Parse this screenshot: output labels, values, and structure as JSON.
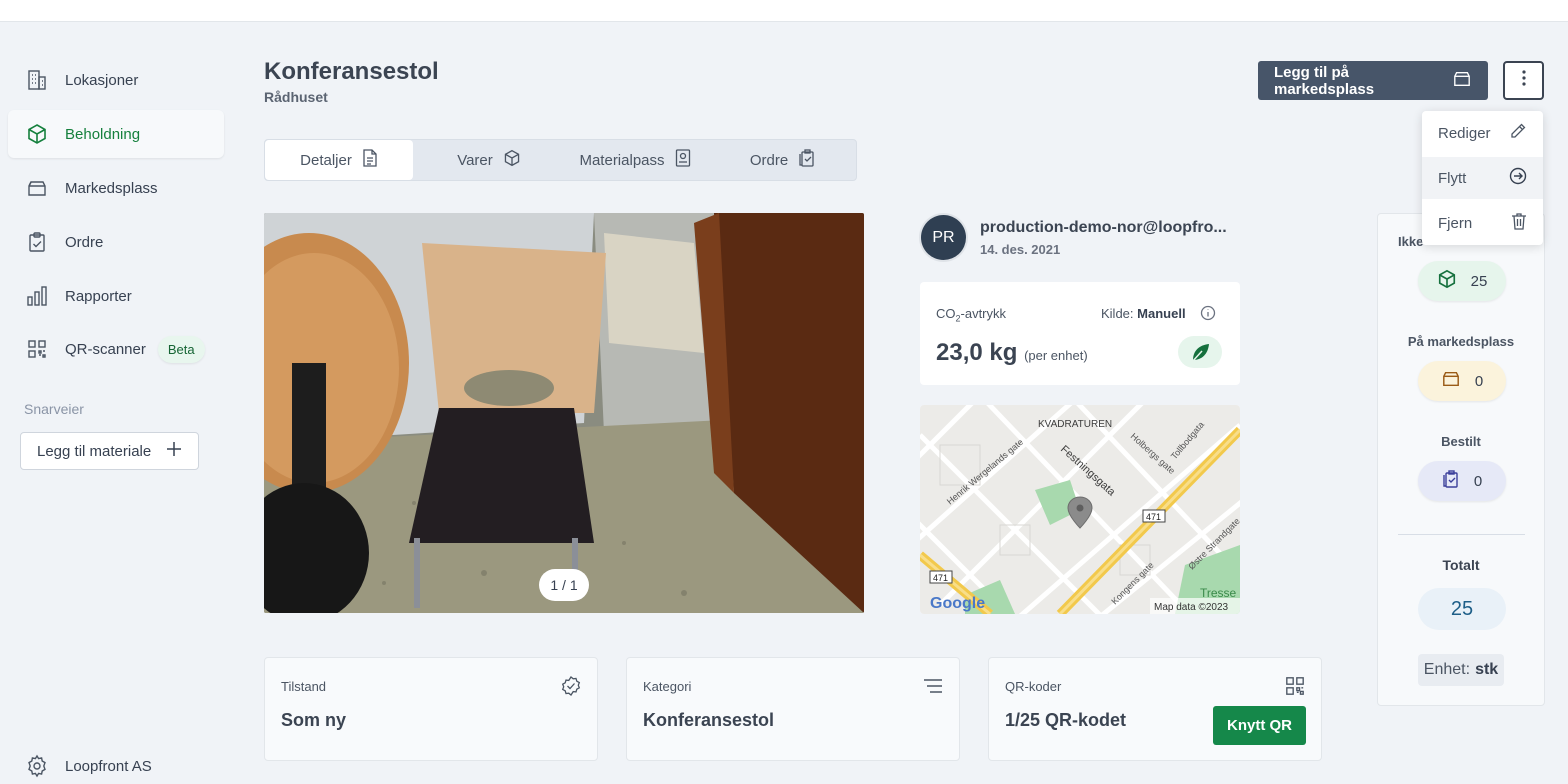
{
  "sidebar": {
    "items": [
      {
        "label": "Lokasjoner",
        "icon": "building-icon"
      },
      {
        "label": "Beholdning",
        "icon": "cube-icon"
      },
      {
        "label": "Markedsplass",
        "icon": "storage-icon"
      },
      {
        "label": "Ordre",
        "icon": "clipboard-check-icon"
      },
      {
        "label": "Rapporter",
        "icon": "bar-chart-icon"
      },
      {
        "label": "QR-scanner",
        "icon": "qr-code-icon",
        "badge": "Beta"
      }
    ],
    "active_index": 1,
    "shortcuts_title": "Snarveier",
    "add_material": "Legg til materiale",
    "organization": "Loopfront AS"
  },
  "header": {
    "title": "Konferansestol",
    "subtitle": "Rådhuset",
    "market_button": "Legg til på markedsplass"
  },
  "dropdown": {
    "items": [
      {
        "label": "Rediger",
        "icon": "pencil-icon"
      },
      {
        "label": "Flytt",
        "icon": "arrow-right-circle-icon"
      },
      {
        "label": "Fjern",
        "icon": "trash-icon"
      }
    ]
  },
  "tabs": [
    {
      "label": "Detaljer",
      "icon": "document-icon"
    },
    {
      "label": "Varer",
      "icon": "cube-icon"
    },
    {
      "label": "Materialpass",
      "icon": "id-badge-icon"
    },
    {
      "label": "Ordre",
      "icon": "clipboard-copy-icon"
    }
  ],
  "photo": {
    "counter": "1 / 1"
  },
  "owner": {
    "initials": "PR",
    "email": "production-demo-nor@loopfro...",
    "date": "14. des. 2021"
  },
  "co2": {
    "label_prefix": "CO",
    "label_sub": "2",
    "label_suffix": "-avtrykk",
    "source_label": "Kilde:",
    "source_value": "Manuell",
    "value": "23,0 kg",
    "unit": "(per enhet)"
  },
  "map": {
    "labels": {
      "district": "KVADRATUREN",
      "street1": "Henrik Wergelands gate",
      "street2": "Festningsgata",
      "street3": "Holbergs gate",
      "street4": "Tollbodgata",
      "street5": "Kongens gate",
      "street6": "Østre Strandgate",
      "road_num": "471",
      "place": "Tresse"
    },
    "logo": "Google",
    "attribution": "Map data ©2023"
  },
  "stats": {
    "first_label": "Ikke",
    "first_value": "25",
    "market_label": "På markedsplass",
    "market_value": "0",
    "ordered_label": "Bestilt",
    "ordered_value": "0",
    "total_label": "Totalt",
    "total_value": "25",
    "unit_label": "Enhet:",
    "unit_value": "stk"
  },
  "cards": {
    "condition_label": "Tilstand",
    "condition_value": "Som ny",
    "category_label": "Kategori",
    "category_value": "Konferansestol",
    "qr_label": "QR-koder",
    "qr_value": "1/25 QR-kodet",
    "qr_button": "Knytt QR"
  },
  "colors": {
    "accent_green": "#15884a",
    "dark_button": "#475569",
    "active_nav": "#15803d"
  }
}
